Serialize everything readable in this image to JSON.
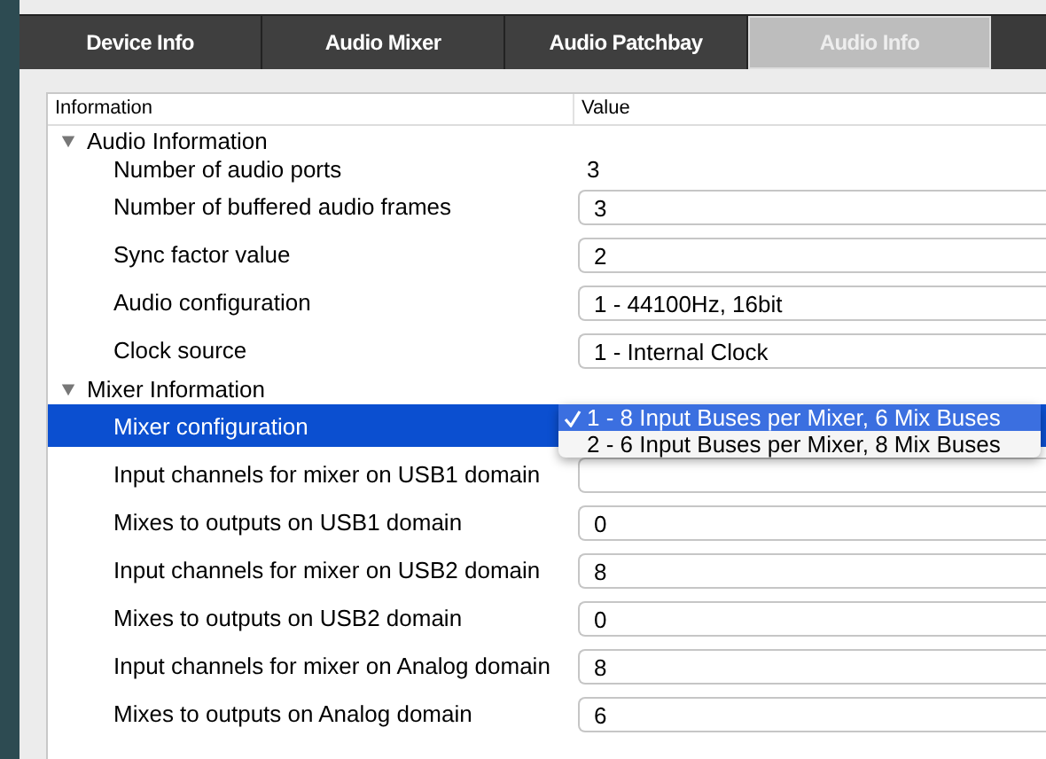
{
  "tabs": [
    {
      "label": "Device Info",
      "selected": false
    },
    {
      "label": "Audio Mixer",
      "selected": false
    },
    {
      "label": "Audio Patchbay",
      "selected": false
    },
    {
      "label": "Audio Info",
      "selected": true
    }
  ],
  "table": {
    "columns": [
      "Information",
      "Value"
    ],
    "groups": [
      {
        "label": "Audio Information",
        "expanded": true,
        "children": [
          {
            "kind": "text",
            "label": "Number of audio ports",
            "value": "3",
            "selected": false
          },
          {
            "kind": "field",
            "label": "Number of buffered audio frames",
            "value": "3",
            "selected": false
          },
          {
            "kind": "field",
            "label": "Sync factor value",
            "value": "2",
            "selected": false
          },
          {
            "kind": "field",
            "label": "Audio configuration",
            "value": "1 - 44100Hz, 16bit",
            "selected": false
          },
          {
            "kind": "field",
            "label": "Clock source",
            "value": "1 - Internal Clock",
            "selected": false
          }
        ]
      },
      {
        "label": "Mixer Information",
        "expanded": true,
        "children": [
          {
            "kind": "dropdown",
            "label": "Mixer configuration",
            "selected": true,
            "options": [
              {
                "label": "1 - 8 Input Buses per Mixer, 6 Mix Buses",
                "selected": true
              },
              {
                "label": "2 - 6 Input Buses per Mixer, 8 Mix Buses",
                "selected": false
              }
            ]
          },
          {
            "kind": "field",
            "label": "Input channels for mixer on USB1 domain",
            "selected": false
          },
          {
            "kind": "field",
            "label": "Mixes to outputs on USB1 domain",
            "value": "0",
            "selected": false
          },
          {
            "kind": "field",
            "label": "Input channels for mixer on USB2 domain",
            "value": "8",
            "selected": false
          },
          {
            "kind": "field",
            "label": "Mixes to outputs on USB2 domain",
            "value": "0",
            "selected": false
          },
          {
            "kind": "field",
            "label": "Input channels for mixer on Analog domain",
            "value": "8",
            "selected": false
          },
          {
            "kind": "field",
            "label": "Mixes to outputs on Analog domain",
            "value": "6",
            "selected": false
          }
        ]
      }
    ]
  }
}
